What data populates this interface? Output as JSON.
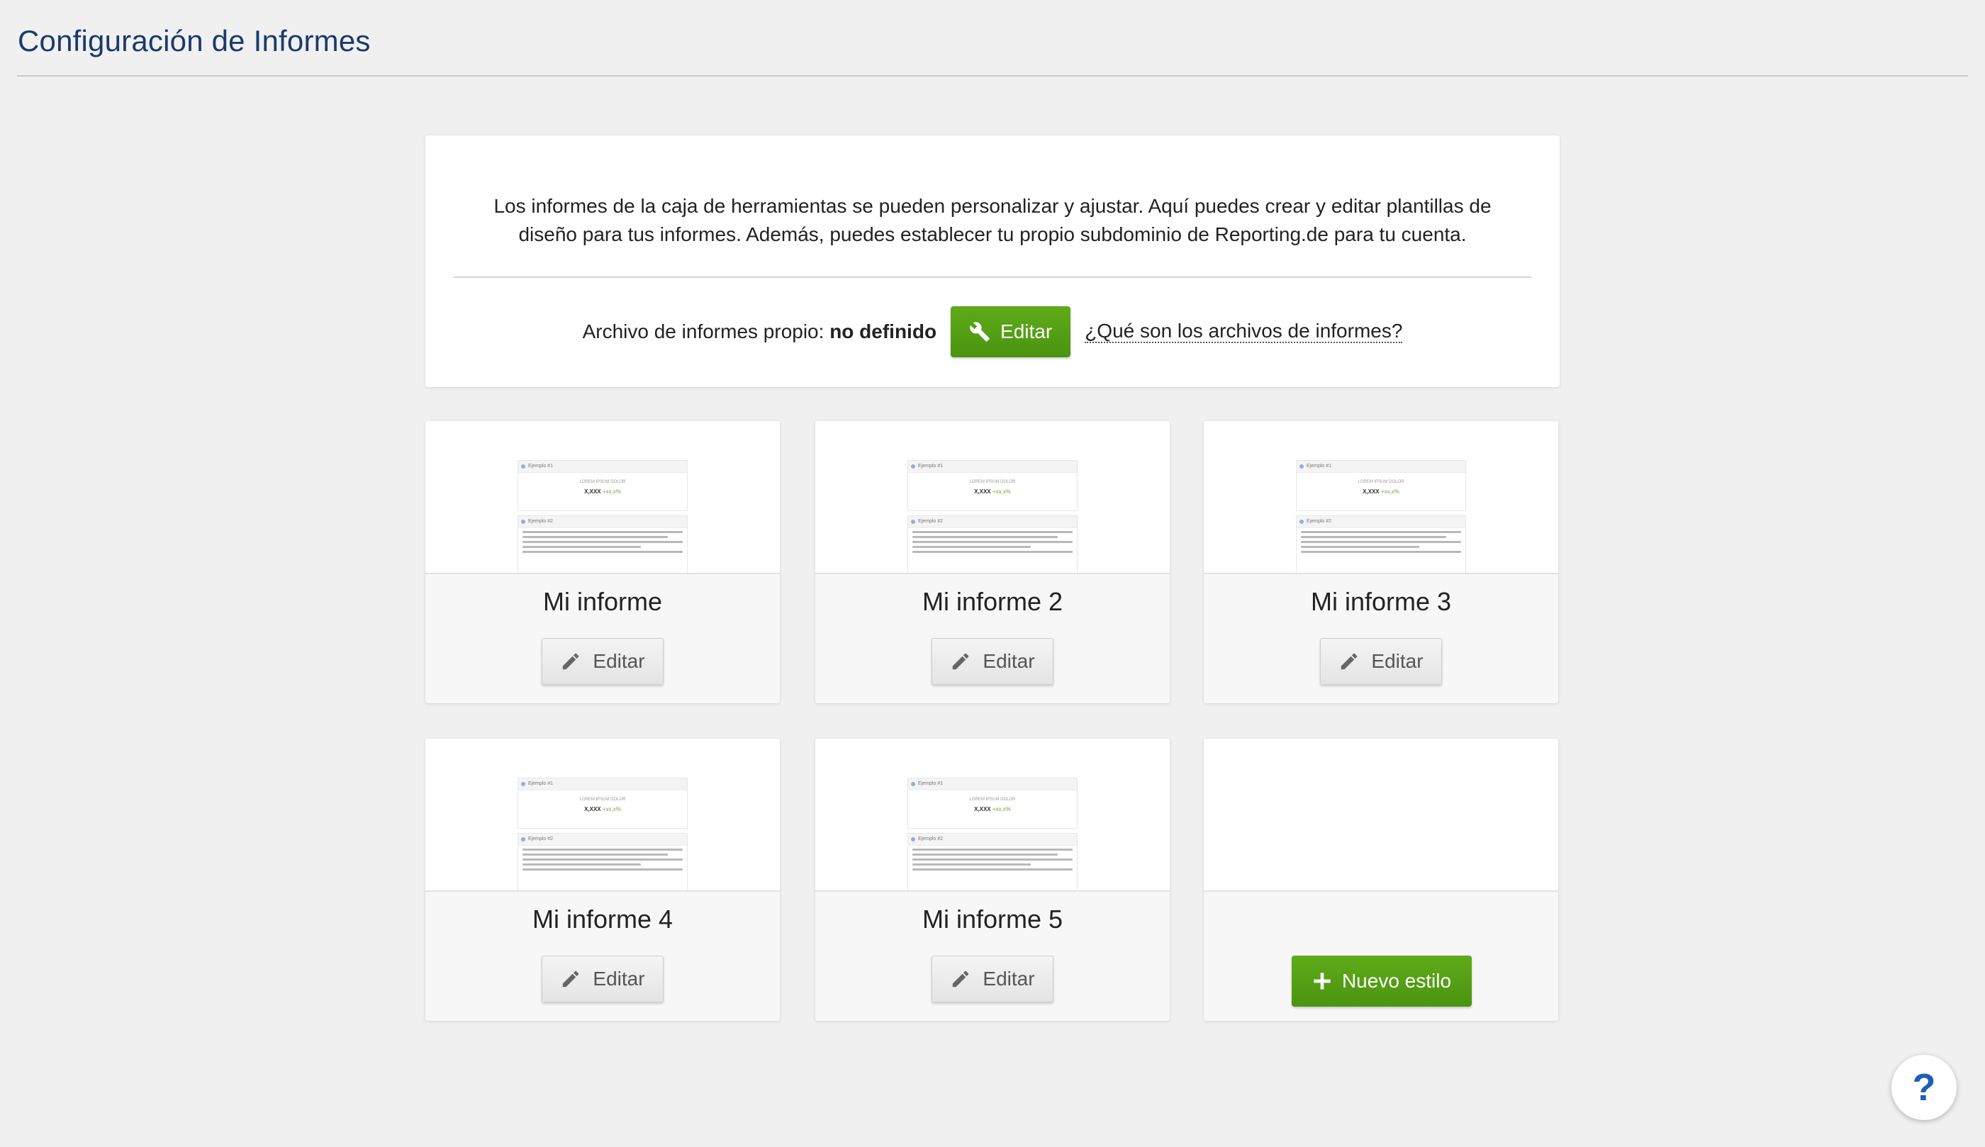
{
  "header": {
    "title": "Configuración de Informes"
  },
  "intro": {
    "text": "Los informes de la caja de herramientas se pueden personalizar y ajustar. Aquí puedes crear y editar plantillas de diseño para tus informes. Además, puedes establecer tu propio subdominio de Reporting.de para tu cuenta.",
    "archive_label": "Archivo de informes propio:",
    "archive_value": "no definido",
    "edit_label": "Editar",
    "help_link": "¿Qué son los archivos de informes?"
  },
  "thumbnail": {
    "box1_title": "Ejemplo #1",
    "box1_caption": "LOREM IPSUM DOLOR",
    "box1_value": "X,XXX",
    "box1_change": "+xx,x%",
    "box2_title": "Ejemplo #2"
  },
  "cards": [
    {
      "title": "Mi informe",
      "edit_label": "Editar"
    },
    {
      "title": "Mi informe 2",
      "edit_label": "Editar"
    },
    {
      "title": "Mi informe 3",
      "edit_label": "Editar"
    },
    {
      "title": "Mi informe 4",
      "edit_label": "Editar"
    },
    {
      "title": "Mi informe 5",
      "edit_label": "Editar"
    }
  ],
  "new_style": {
    "label": "Nuevo estilo"
  },
  "help_fab": {
    "label": "?"
  },
  "colors": {
    "accent_green": "#4f9a12",
    "title_blue": "#1b3a6b",
    "help_blue": "#1f5fb4"
  },
  "icons": {
    "archive_edit": "wrench-icon",
    "card_edit": "pencil-icon",
    "new": "plus-icon"
  }
}
